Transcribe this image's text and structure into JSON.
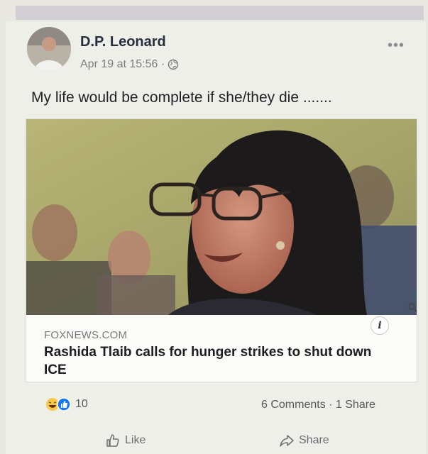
{
  "post": {
    "author": "D.P. Leonard",
    "timestamp": "Apr 19 at 15:56 · ",
    "text": "My life would be complete if she/they die .......",
    "more_label": "•••"
  },
  "link": {
    "source": "FOXNEWS.COM",
    "headline": "Rashida Tlaib calls for hunger strikes to shut down ICE",
    "info_label": "i"
  },
  "engagement": {
    "reaction_count": "10",
    "summary": "6 Comments · 1 Share"
  },
  "actions": {
    "like_label": "Like",
    "share_label": "Share"
  },
  "colors": {
    "like_blue": "#1877f2",
    "haha_yellow": "#f7c948"
  },
  "icons": [
    "globe-icon",
    "more-icon",
    "info-icon",
    "zoom-icon",
    "haha-reaction-icon",
    "like-reaction-icon",
    "like-thumb-icon",
    "share-arrow-icon"
  ]
}
